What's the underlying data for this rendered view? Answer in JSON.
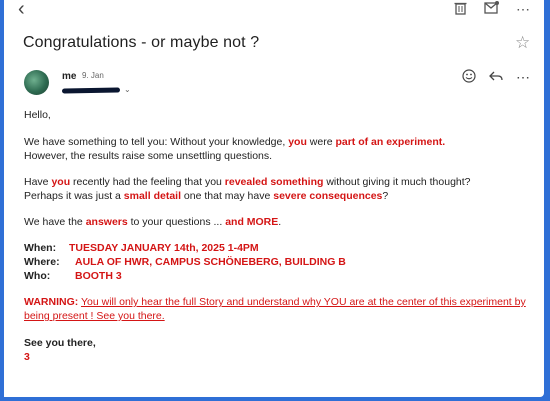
{
  "email": {
    "subject": "Congratulations - or maybe not ?",
    "sender": "me",
    "date": "9. Jan",
    "greeting": "Hello,",
    "p1": {
      "a": "We have something to tell you: Without your knowledge, ",
      "b": "you",
      "c": " were ",
      "d": "part of an experiment.",
      "e": "However, the results raise some unsettling questions."
    },
    "p2": {
      "a": "Have ",
      "b": "you",
      "c": " recently had the feeling that you ",
      "d": "revealed something",
      "e": " without giving it much thought?",
      "f": "Perhaps it was just a ",
      "g": "small detail",
      "h": " one that may have ",
      "i": "severe consequences",
      "j": "?"
    },
    "p3": {
      "a": "We have the ",
      "b": "answers",
      "c": " to your questions ... ",
      "d": "and MORE",
      "e": "."
    },
    "details": [
      {
        "label": "When:",
        "value": "TUESDAY JANUARY 14th, 2025 1-4PM"
      },
      {
        "label": "Where:",
        "value": "AULA OF HWR, CAMPUS SCHÖNEBERG, BUILDING B"
      },
      {
        "label": "Who:",
        "value": "BOOTH 3"
      }
    ],
    "warning": {
      "label": "WARNING:",
      "text": "You will only hear the full Story and understand why YOU are at the center of this experiment by being present ! See you there."
    },
    "signoff": "See you there,",
    "signature": "3"
  },
  "icons": {
    "back": "back-arrow-icon",
    "delete": "trash-icon",
    "mark": "mail-icon",
    "more": "more-icon",
    "star": "star-icon",
    "emoji": "emoji-icon",
    "reply": "reply-icon"
  }
}
